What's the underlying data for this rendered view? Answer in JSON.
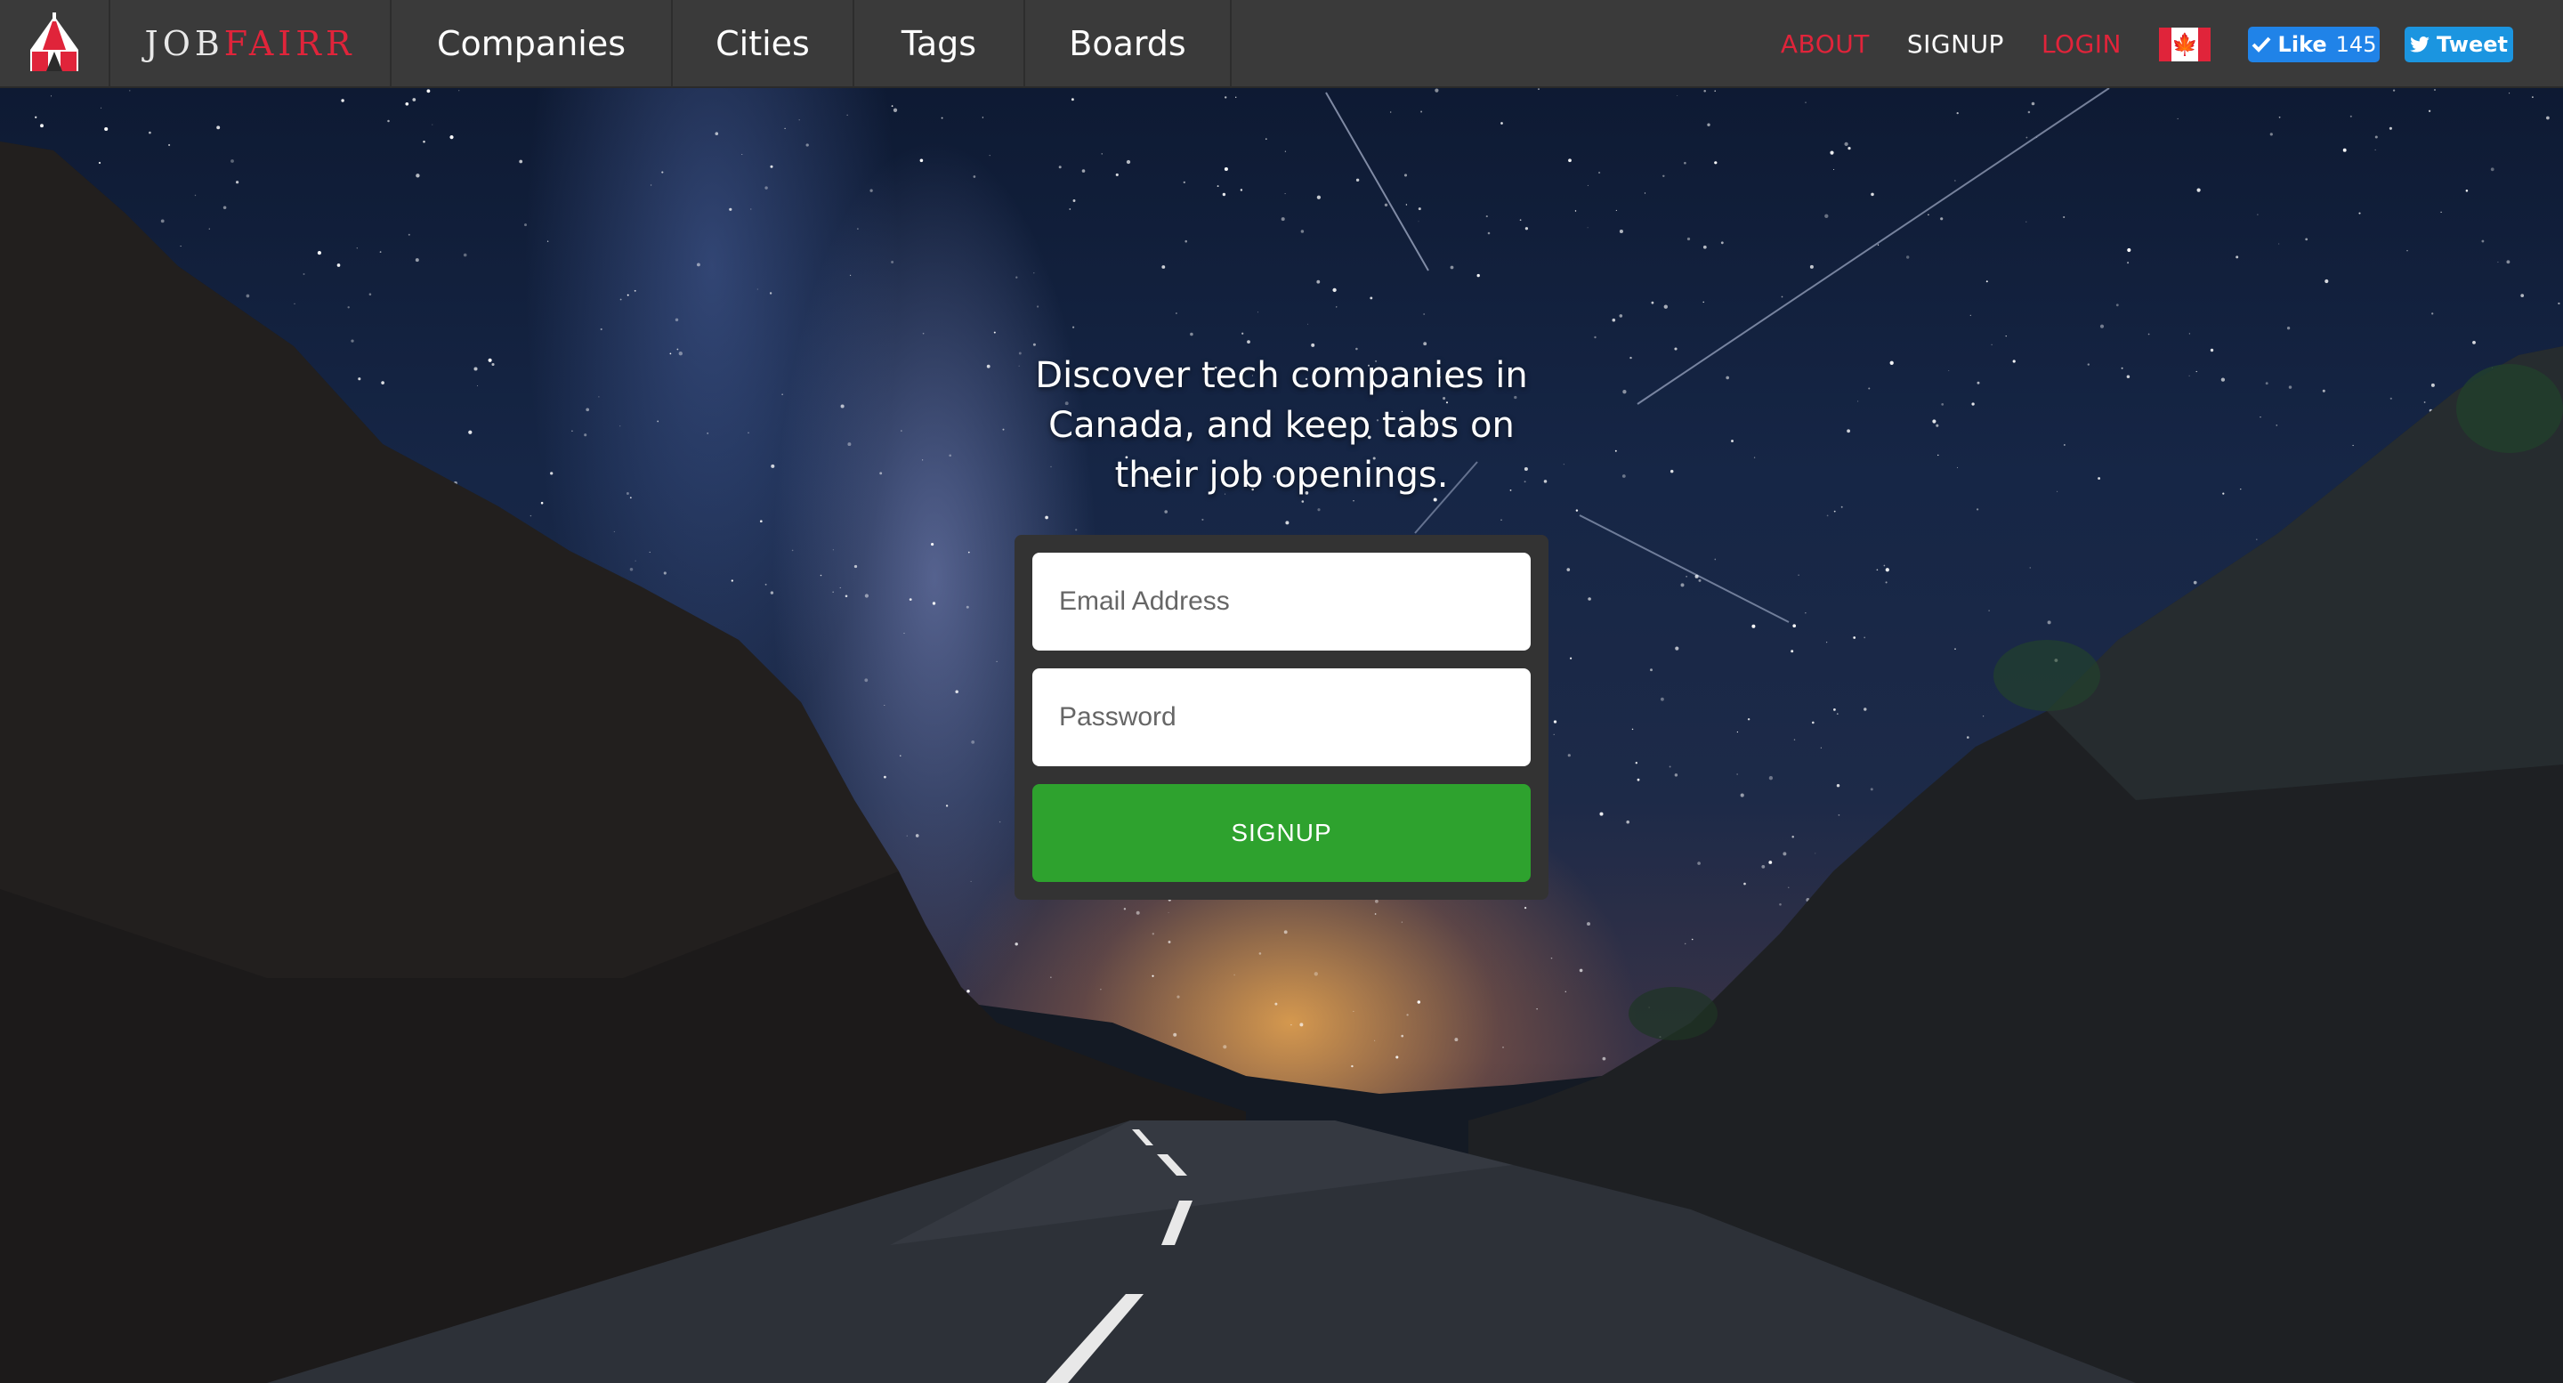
{
  "nav": {
    "brand_part1": "JOB",
    "brand_part2": "FAIRR",
    "items": [
      {
        "label": "Companies"
      },
      {
        "label": "Cities"
      },
      {
        "label": "Tags"
      },
      {
        "label": "Boards"
      }
    ],
    "about": "ABOUT",
    "signup": "SIGNUP",
    "login": "LOGIN",
    "flag_icon": "canada-flag-icon",
    "like_label": "Like",
    "like_count": "145",
    "tweet_label": "Tweet"
  },
  "hero": {
    "tagline_line1": "Discover tech companies in",
    "tagline_line2": "Canada, and keep tabs on",
    "tagline_line3": "their job openings.",
    "email_placeholder": "Email Address",
    "password_placeholder": "Password",
    "submit_label": "SIGNUP"
  },
  "colors": {
    "accent_red": "#e0243a",
    "nav_bg": "#3a3a3a",
    "signup_green": "#2ea22e",
    "like_blue": "#2083e8"
  }
}
